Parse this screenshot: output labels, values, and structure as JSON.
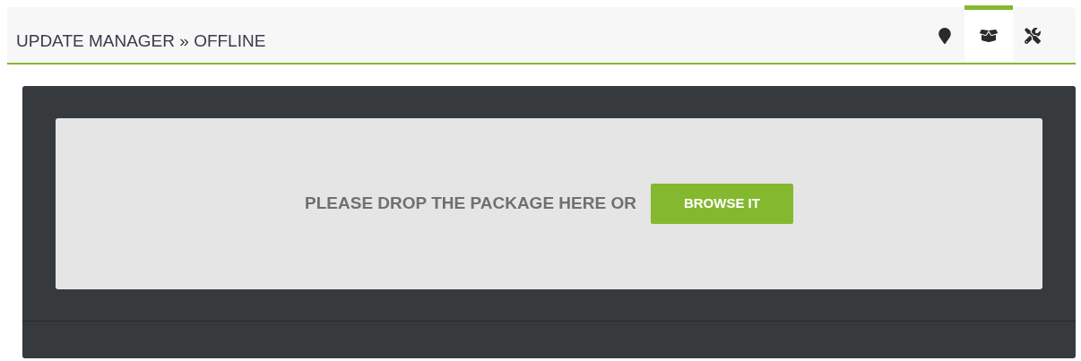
{
  "header": {
    "title": "UPDATE MANAGER » OFFLINE"
  },
  "tabs": [
    {
      "kind": "location",
      "selected": false
    },
    {
      "kind": "package",
      "selected": true
    },
    {
      "kind": "tools",
      "selected": false
    }
  ],
  "dropzone": {
    "message": "PLEASE DROP THE PACKAGE HERE OR",
    "button": "BROWSE IT"
  }
}
